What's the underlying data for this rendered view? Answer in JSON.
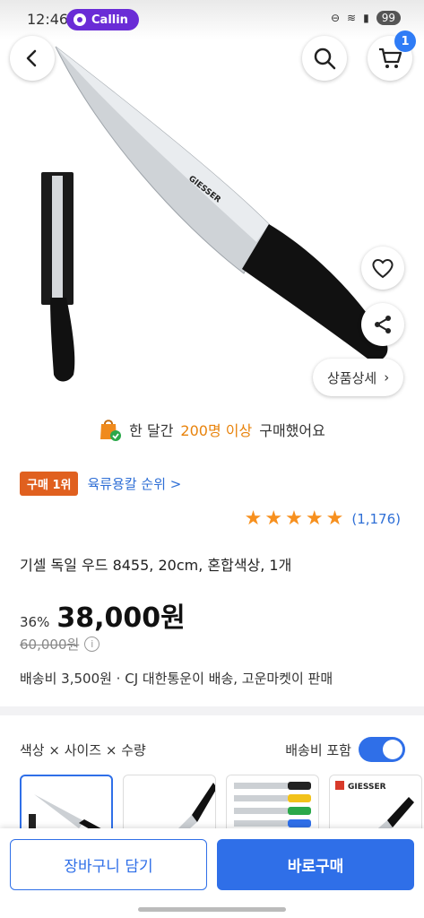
{
  "status": {
    "time": "12:46",
    "app": "Callin",
    "battery": "99"
  },
  "header": {
    "cart_count": "1",
    "back_icon": "chevron-left-icon",
    "search_icon": "search-icon",
    "cart_icon": "cart-icon"
  },
  "hero": {
    "brand": "GIESSER",
    "detail_label": "상품상세",
    "detail_arrow": "›"
  },
  "notice": {
    "prefix": "한 달간",
    "highlight": "200명 이상",
    "suffix": "구매했어요"
  },
  "rank": {
    "badge": "구매 1위",
    "link": "육류용칼 순위 >"
  },
  "rating": {
    "stars": 5,
    "count": "(1,176)"
  },
  "product": {
    "title": "기셀 독일 우드 8455, 20cm, 혼합색상, 1개"
  },
  "price": {
    "discount": "36%",
    "sale": "38,000원",
    "original": "60,000원"
  },
  "shipping": {
    "text": "배송비 3,500원 · CJ 대한통운이 배송, 고운마켓이 판매"
  },
  "options": {
    "label": "색상 × 사이즈 × 수량",
    "free_shipping": "배송비 포함",
    "free_shipping_on": true
  },
  "actions": {
    "cart": "장바구니 담기",
    "buy": "바로구매"
  },
  "colors": {
    "accent": "#2f6fe8",
    "rank": "#e0601f",
    "star": "#f7901e",
    "highlight": "#e8830c"
  }
}
